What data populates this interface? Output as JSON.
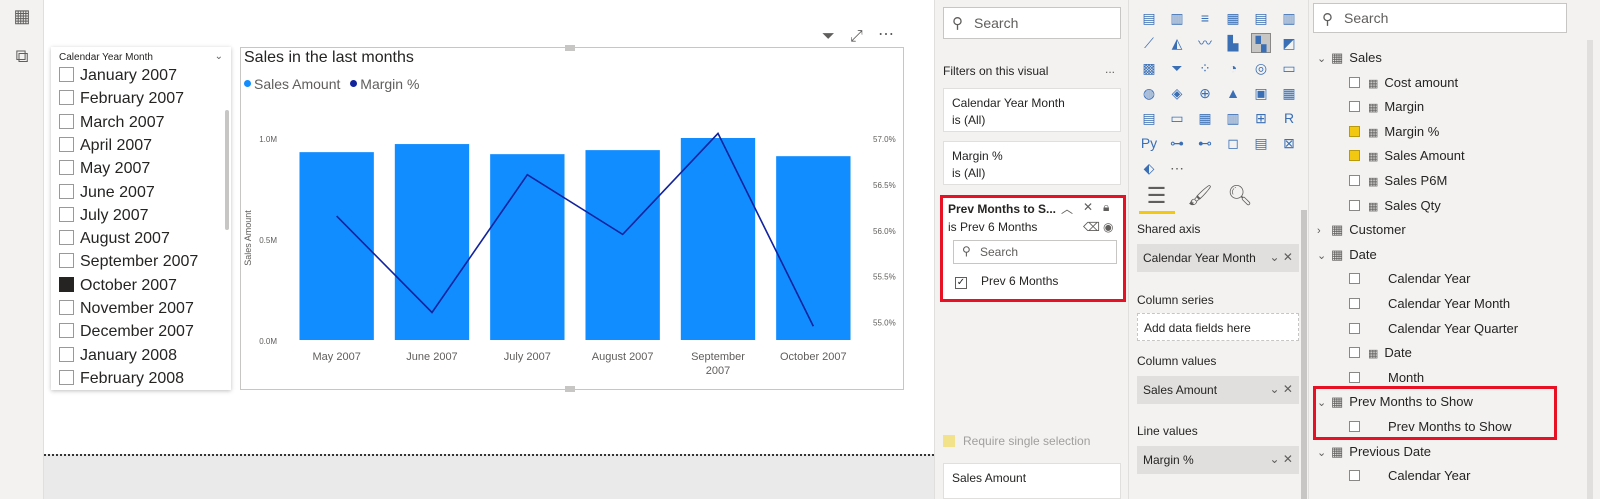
{
  "rail": {
    "icons": [
      "table-icon",
      "model-icon"
    ]
  },
  "slicer": {
    "title": "Calendar Year Month",
    "items": [
      {
        "label": "January 2007",
        "checked": false
      },
      {
        "label": "February 2007",
        "checked": false
      },
      {
        "label": "March 2007",
        "checked": false
      },
      {
        "label": "April 2007",
        "checked": false
      },
      {
        "label": "May 2007",
        "checked": false
      },
      {
        "label": "June 2007",
        "checked": false
      },
      {
        "label": "July 2007",
        "checked": false
      },
      {
        "label": "August 2007",
        "checked": false
      },
      {
        "label": "September 2007",
        "checked": false
      },
      {
        "label": "October 2007",
        "checked": true
      },
      {
        "label": "November 2007",
        "checked": false
      },
      {
        "label": "December 2007",
        "checked": false
      },
      {
        "label": "January 2008",
        "checked": false
      },
      {
        "label": "February 2008",
        "checked": false
      }
    ]
  },
  "chart": {
    "title": "Sales in the last months",
    "legend": [
      "Sales Amount",
      "Margin %"
    ]
  },
  "chart_data": {
    "type": "bar",
    "title": "Sales in the last months",
    "categories": [
      "May 2007",
      "June 2007",
      "July 2007",
      "August 2007",
      "September 2007",
      "October 2007"
    ],
    "series": [
      {
        "name": "Sales Amount",
        "type": "bar",
        "axis": "left",
        "color": "#118dff",
        "values": [
          0.93,
          0.97,
          0.92,
          0.94,
          1.0,
          0.91
        ]
      },
      {
        "name": "Margin %",
        "type": "line",
        "axis": "right",
        "color": "#12239e",
        "values": [
          56.15,
          55.1,
          56.6,
          55.95,
          57.05,
          54.95
        ]
      }
    ],
    "xlabel": "",
    "ylabel": "Sales Amount",
    "ylim": [
      0,
      1.0
    ],
    "y_ticks": [
      "0.0M",
      "0.5M",
      "1.0M"
    ],
    "y2lim": [
      54.8,
      57.0
    ],
    "y2_ticks": [
      "55.0%",
      "55.5%",
      "56.0%",
      "56.5%",
      "57.0%"
    ]
  },
  "filters": {
    "search_placeholder": "Search",
    "section_title": "Filters on this visual",
    "more": "...",
    "cards": [
      {
        "name": "Calendar Year Month",
        "state": "is (All)"
      },
      {
        "name": "Margin %",
        "state": "is (All)"
      }
    ],
    "active": {
      "name": "Prev Months to S...",
      "state": "is Prev 6 Months",
      "search": "Search",
      "option": "Prev 6 Months"
    },
    "require_single": "Require single selection",
    "bottom_card": "Sales Amount"
  },
  "viz": {
    "more": "...",
    "wells": {
      "shared_axis": {
        "label": "Shared axis",
        "value": "Calendar Year Month"
      },
      "column_series": {
        "label": "Column series",
        "value": "Add data fields here"
      },
      "column_values": {
        "label": "Column values",
        "value": "Sales Amount"
      },
      "line_values": {
        "label": "Line values",
        "value": "Margin %"
      }
    }
  },
  "fields": {
    "search_placeholder": "Search",
    "rows": [
      {
        "label": "Sales",
        "kind": "table",
        "expanded": true,
        "indent": 0
      },
      {
        "label": "Cost amount",
        "kind": "measure",
        "checked": false,
        "indent": 1
      },
      {
        "label": "Margin",
        "kind": "measure",
        "checked": false,
        "indent": 1
      },
      {
        "label": "Margin %",
        "kind": "measure",
        "checked": true,
        "indent": 1
      },
      {
        "label": "Sales Amount",
        "kind": "measure",
        "checked": true,
        "indent": 1
      },
      {
        "label": "Sales P6M",
        "kind": "measure",
        "checked": false,
        "indent": 1
      },
      {
        "label": "Sales Qty",
        "kind": "measure",
        "checked": false,
        "indent": 1
      },
      {
        "label": "Customer",
        "kind": "table",
        "expanded": false,
        "indent": 0
      },
      {
        "label": "Date",
        "kind": "table",
        "expanded": true,
        "indent": 0
      },
      {
        "label": "Calendar Year",
        "kind": "field",
        "checked": false,
        "indent": 1
      },
      {
        "label": "Calendar Year Month",
        "kind": "field",
        "checked": false,
        "indent": 1
      },
      {
        "label": "Calendar Year Quarter",
        "kind": "field",
        "checked": false,
        "indent": 1
      },
      {
        "label": "Date",
        "kind": "hierarchy",
        "checked": false,
        "indent": 1
      },
      {
        "label": "Month",
        "kind": "field",
        "checked": false,
        "indent": 1
      },
      {
        "label": "Prev Months to Show",
        "kind": "table",
        "expanded": true,
        "indent": 0
      },
      {
        "label": "Prev Months to Show",
        "kind": "field",
        "checked": false,
        "indent": 1
      },
      {
        "label": "Previous Date",
        "kind": "table",
        "expanded": true,
        "indent": 0
      },
      {
        "label": "Calendar Year",
        "kind": "field",
        "checked": false,
        "indent": 1
      }
    ]
  }
}
